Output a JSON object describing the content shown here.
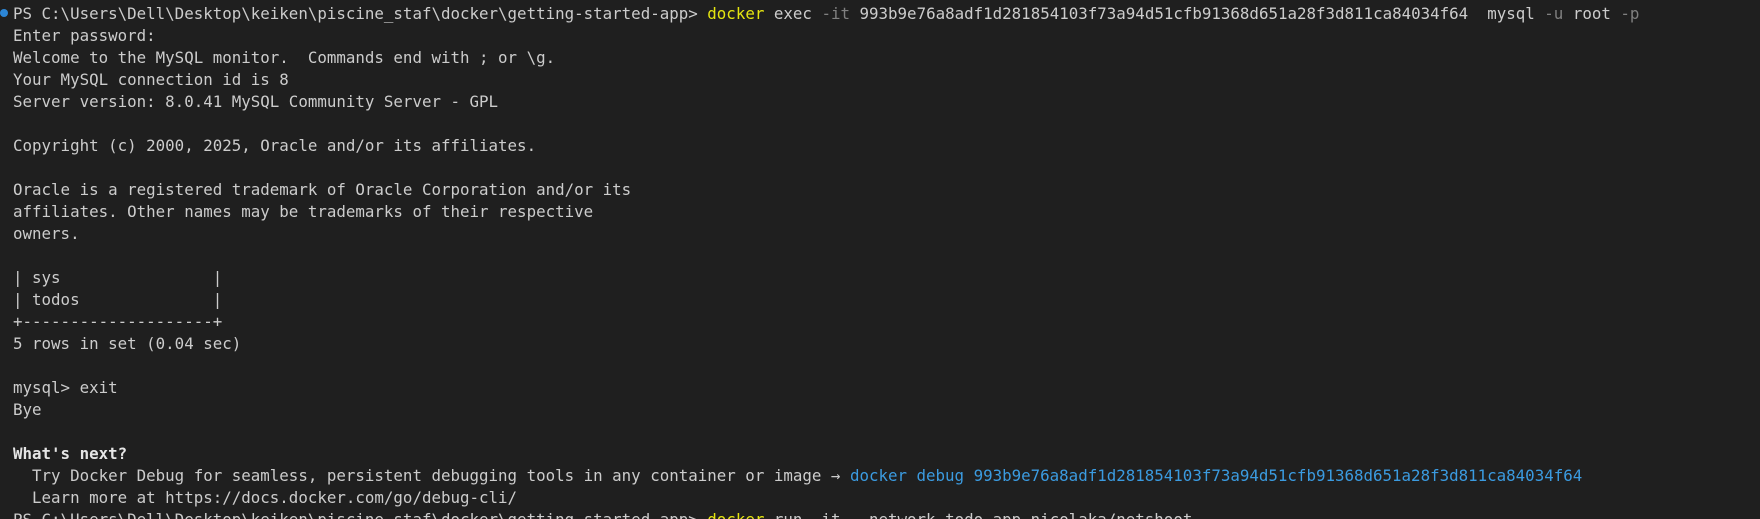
{
  "terminal": {
    "prompt_line": {
      "prompt": "PS C:\\Users\\Dell\\Desktop\\keiken\\piscine_staf\\docker\\getting-started-app>",
      "command": "docker",
      "sub": "exec",
      "flag_it": "-it",
      "container_id": "993b9e76a8adf1d281854103f73a94d51cfb91368d651a28f3d811ca84034f64",
      "program": "mysql",
      "flag_u": "-u",
      "user": "root",
      "flag_p": "-p"
    },
    "output": {
      "enter_password": "Enter password:",
      "welcome": "Welcome to the MySQL monitor.  Commands end with ; or \\g.",
      "connection_id": "Your MySQL connection id is 8",
      "server_version": "Server version: 8.0.41 MySQL Community Server - GPL",
      "copyright": "Copyright (c) 2000, 2025, Oracle and/or its affiliates.",
      "trademark_1": "Oracle is a registered trademark of Oracle Corporation and/or its",
      "trademark_2": "affiliates. Other names may be trademarks of their respective",
      "trademark_3": "owners.",
      "row_sys": "| sys                |",
      "row_todos": "| todos              |",
      "table_border": "+--------------------+",
      "rows_in_set": "5 rows in set (0.04 sec)",
      "mysql_exit": "mysql> exit",
      "bye": "Bye",
      "whats_next": "What's next?",
      "try_debug_text": "  Try Docker Debug for seamless, persistent debugging tools in any container or image → ",
      "debug_command": "docker debug 993b9e76a8adf1d281854103f73a94d51cfb91368d651a28f3d811ca84034f64",
      "learn_more": "  Learn more at https://docs.docker.com/go/debug-cli/"
    },
    "next_prompt": {
      "prompt": "PS C:\\Users\\Dell\\Desktop\\keiken\\piscine_staf\\docker\\getting-started-app>",
      "command": "docker",
      "rest": "run -it --network todo-app nicolaka/netshoot"
    }
  },
  "colors": {
    "background": "#1f1f1f",
    "foreground": "#cccccc",
    "command_yellow": "#e5e510",
    "flag_gray": "#808080",
    "link_blue": "#3b9be0",
    "gutter_dot": "#2c86d6"
  }
}
